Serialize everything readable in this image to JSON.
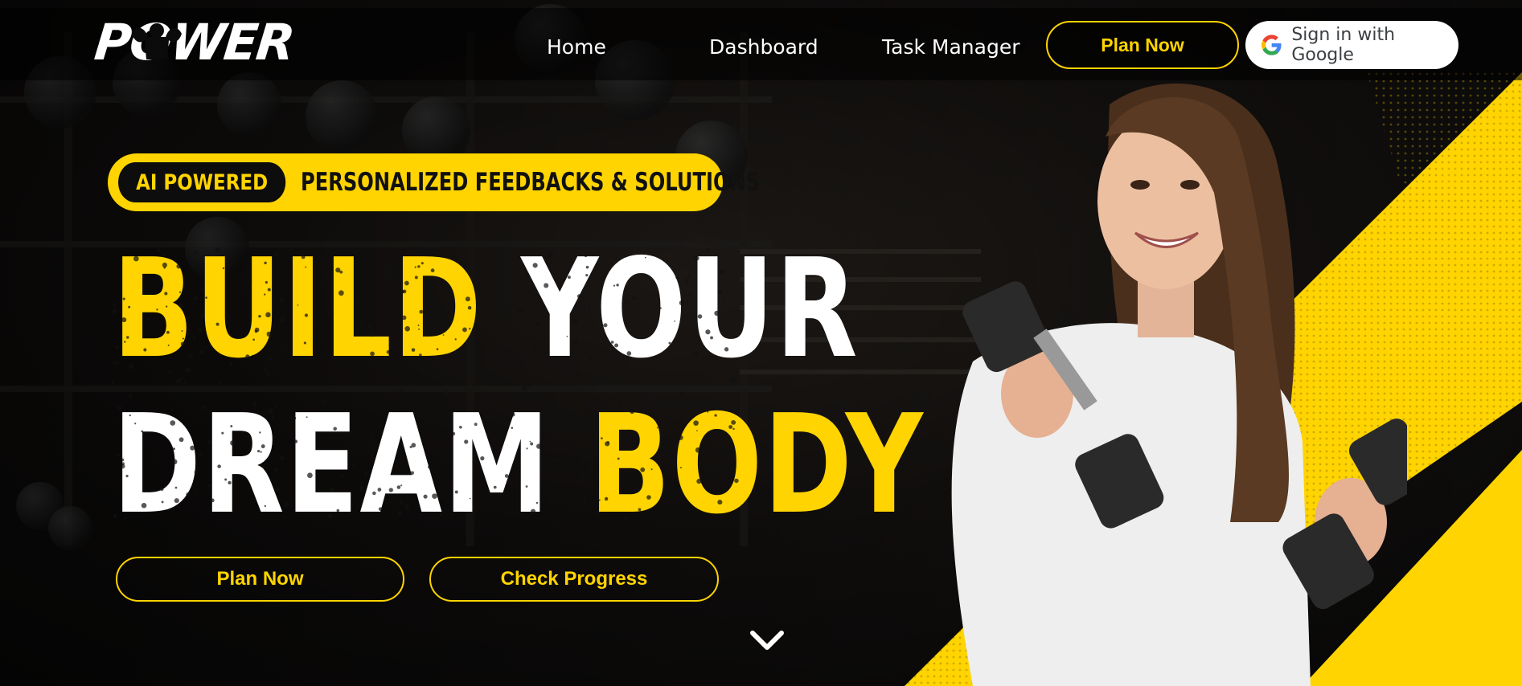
{
  "app": {
    "logo_text": "POWER"
  },
  "nav": {
    "links": [
      "Home",
      "Dashboard",
      "Task Manager"
    ],
    "plan_button": "Plan Now",
    "google_button": "Sign in with Google"
  },
  "hero": {
    "badge": "AI POWERED",
    "tagline": "PERSONALIZED FEEDBACKS & SOLUTIONS",
    "headline": {
      "line1_a": "BUILD",
      "line1_b": "YOUR",
      "line2_a": "DREAM",
      "line2_b": "BODY"
    },
    "primary_cta": "Plan Now",
    "secondary_cta": "Check Progress"
  },
  "icons": {
    "google": "google-g-icon",
    "scroll": "chevron-down-icon",
    "logo_figure": "bodybuilder-silhouette-icon"
  },
  "colors": {
    "accent": "#ffd400",
    "background": "#0b0b0b",
    "text": "#ffffff"
  }
}
